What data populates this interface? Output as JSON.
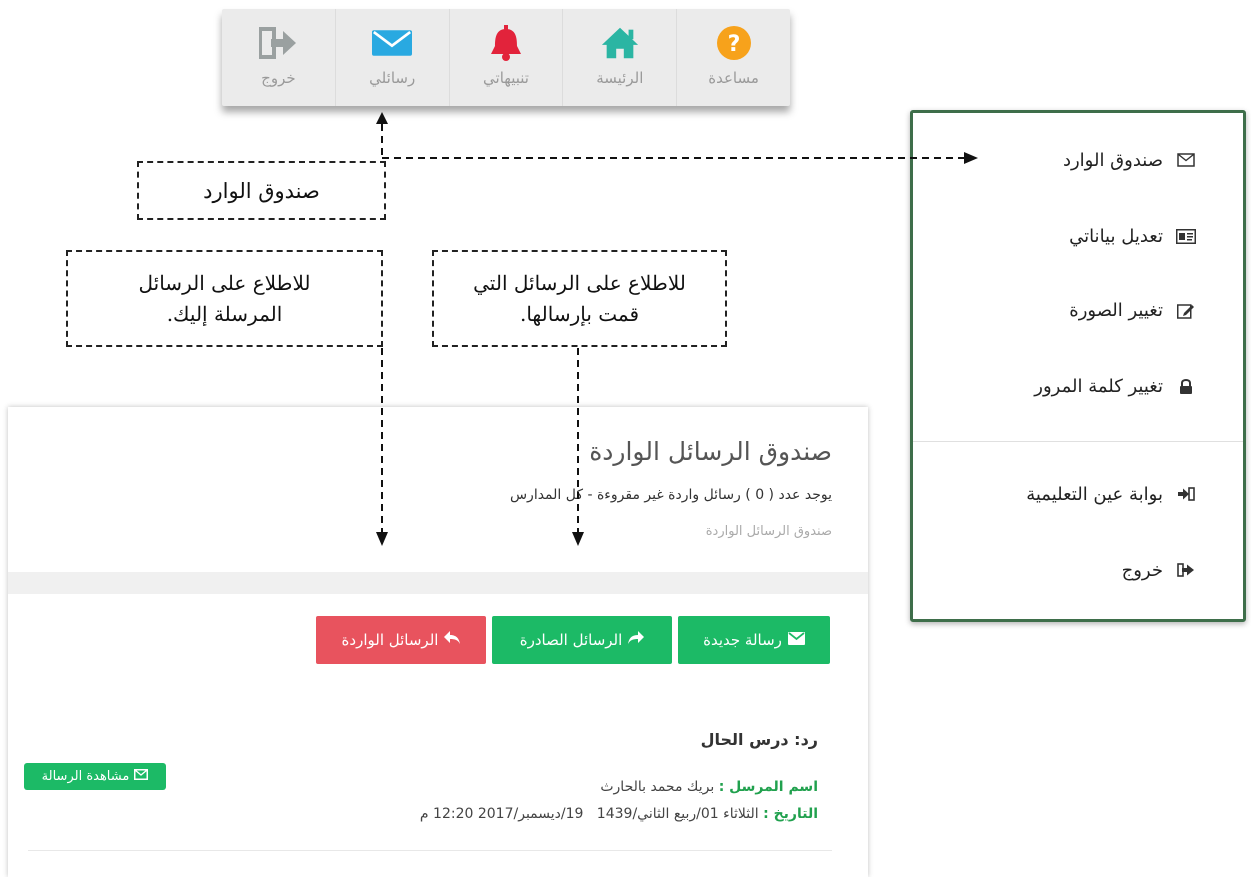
{
  "topbar": {
    "items": [
      {
        "key": "logout",
        "label": "خروج",
        "icon": "sign-out-icon",
        "color": "#9aa0a0"
      },
      {
        "key": "messages",
        "label": "رسائلي",
        "icon": "envelope-icon",
        "color": "#29a9e1"
      },
      {
        "key": "notifications",
        "label": "تنبيهاتي",
        "icon": "bell-icon",
        "color": "#e2233b"
      },
      {
        "key": "home",
        "label": "الرئيسة",
        "icon": "home-icon",
        "color": "#2bb5a3"
      },
      {
        "key": "help",
        "label": "مساعدة",
        "icon": "question-icon",
        "color": "#f7a21b"
      }
    ]
  },
  "annotations": {
    "inbox": "صندوق الوارد",
    "received_line1": "للاطلاع على الرسائل",
    "received_line2": "المرسلة إليك.",
    "sent_line1": "للاطلاع على الرسائل التي",
    "sent_line2": "قمت بإرسالها."
  },
  "panel": {
    "title": "صندوق الرسائل الواردة",
    "info": "يوجد عدد ( 0 ) رسائل واردة غير مقروءة - كل المدارس",
    "breadcrumb": "صندوق الرسائل الواردة",
    "buttons": {
      "new_message": "رسالة جديدة",
      "sent_messages": "الرسائل الصادرة",
      "inbox_messages": "الرسائل الواردة"
    },
    "message": {
      "subject": "رد: درس الحال",
      "sender_label": "اسم المرسل :",
      "sender_value": "بريك محمد بالحارث",
      "date_label": "التاريخ :",
      "date_value": "الثلاثاء 01/ربيع الثاني/1439   19/ديسمبر/2017 12:20 م",
      "view_button": "مشاهدة الرسالة"
    }
  },
  "menu": {
    "items": [
      {
        "label": "صندوق الوارد",
        "icon": "envelope-outline-icon"
      },
      {
        "label": "تعديل بياناتي",
        "icon": "id-card-icon"
      },
      {
        "label": "تغيير الصورة",
        "icon": "edit-icon"
      },
      {
        "label": "تغيير كلمة المرور",
        "icon": "lock-icon"
      },
      {
        "label": "بوابة عين التعليمية",
        "icon": "sign-in-icon"
      },
      {
        "label": "خروج",
        "icon": "sign-out-icon"
      }
    ]
  },
  "colors": {
    "green": "#1cba66",
    "red": "#e8535e",
    "menu_border": "#3e6e4a"
  }
}
